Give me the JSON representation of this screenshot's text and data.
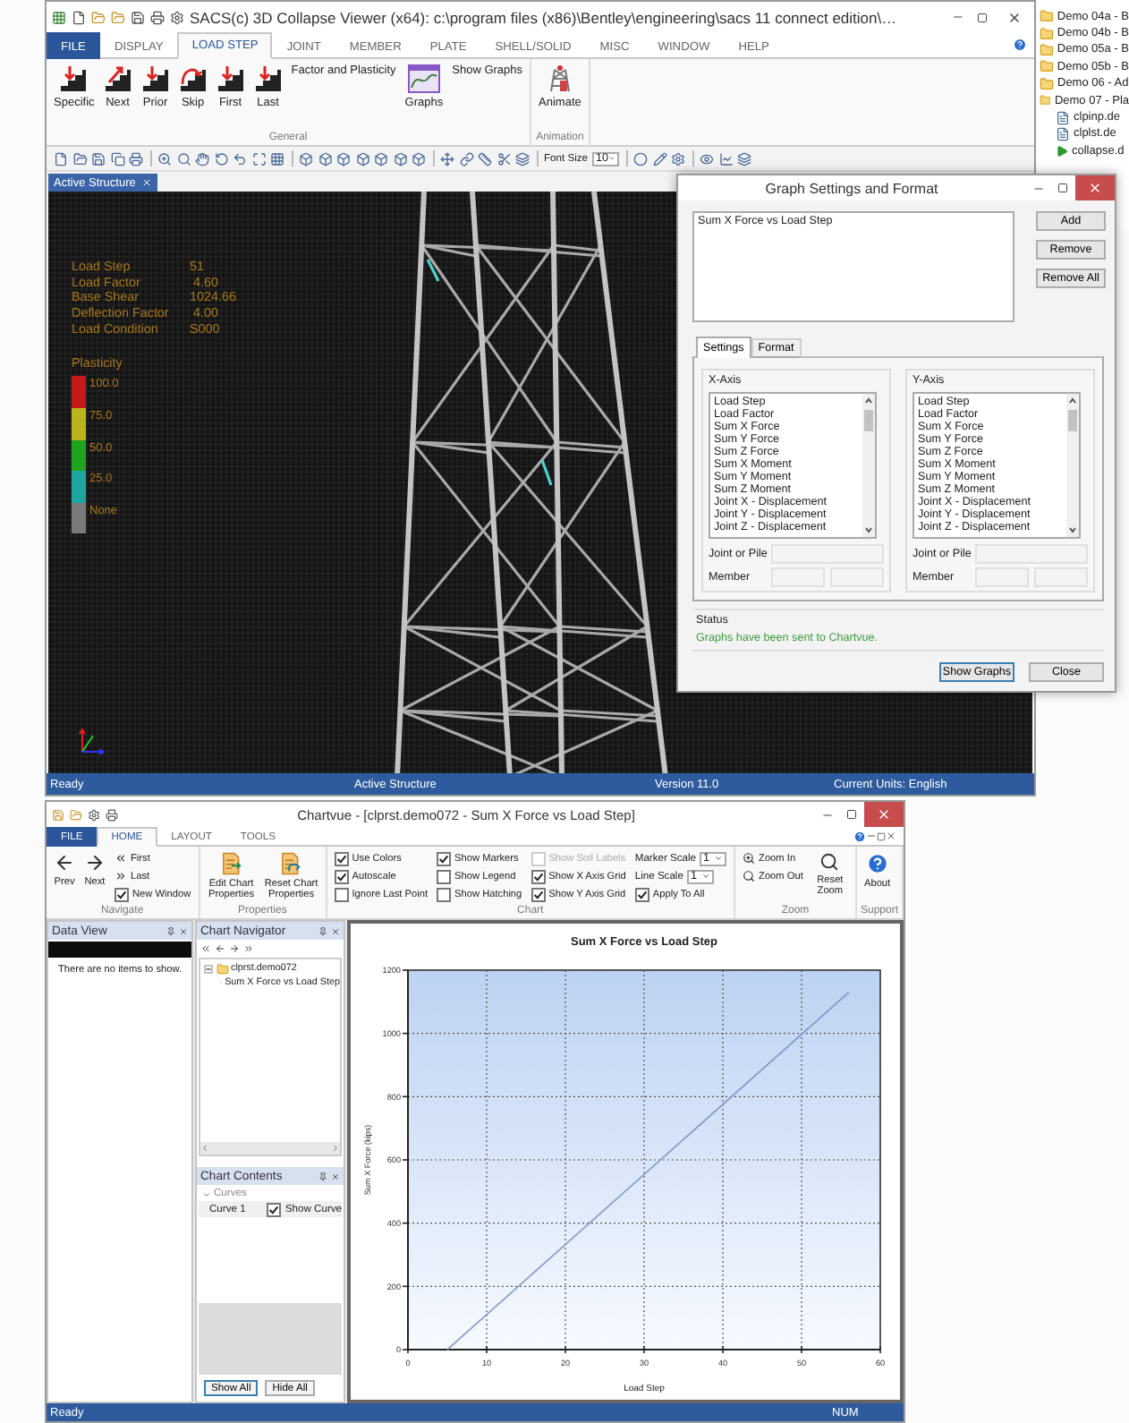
{
  "desktop_files": [
    {
      "label": "Demo 04a - B",
      "kind": "folder"
    },
    {
      "label": "Demo 04b - B",
      "kind": "folder"
    },
    {
      "label": "Demo 05a - B",
      "kind": "folder"
    },
    {
      "label": "Demo 05b - B",
      "kind": "folder"
    },
    {
      "label": "Demo 06 - Ad",
      "kind": "folder"
    },
    {
      "label": "Demo 07 - Pla",
      "kind": "folder"
    },
    {
      "label": "clpinp.de",
      "kind": "file"
    },
    {
      "label": "clplst.de",
      "kind": "file"
    },
    {
      "label": "collapse.d",
      "kind": "run"
    }
  ],
  "sacs_window": {
    "title": "SACS(c) 3D Collapse Viewer (x64):  c:\\program files (x86)\\Bentley\\engineering\\sacs 11 connect edition\\…",
    "tabs": [
      {
        "label": "FILE",
        "kind": "file",
        "selected": false
      },
      {
        "label": "DISPLAY",
        "kind": "tab",
        "selected": false
      },
      {
        "label": "LOAD STEP",
        "kind": "tab",
        "selected": true
      },
      {
        "label": "JOINT",
        "kind": "tab",
        "selected": false
      },
      {
        "label": "MEMBER",
        "kind": "tab",
        "selected": false
      },
      {
        "label": "PLATE",
        "kind": "tab",
        "selected": false
      },
      {
        "label": "SHELL/SOLID",
        "kind": "tab",
        "selected": false
      },
      {
        "label": "MISC",
        "kind": "tab",
        "selected": false
      },
      {
        "label": "WINDOW",
        "kind": "tab",
        "selected": false
      },
      {
        "label": "HELP",
        "kind": "tab",
        "selected": false
      }
    ],
    "ribbon": [
      {
        "label": "General",
        "items": [
          {
            "label": "Specific",
            "kind": "large"
          },
          {
            "label": "Next",
            "kind": "large"
          },
          {
            "label": "Prior",
            "kind": "large"
          },
          {
            "label": "Skip",
            "kind": "large"
          },
          {
            "label": "First",
            "kind": "large"
          },
          {
            "label": "Last",
            "kind": "large"
          },
          {
            "label": "Factor and Plasticity",
            "kind": "text"
          },
          {
            "label": "Graphs",
            "kind": "large"
          },
          {
            "label": "Show Graphs",
            "kind": "text"
          }
        ]
      },
      {
        "label": "Animation",
        "items": [
          {
            "label": "Animate",
            "kind": "large"
          }
        ]
      }
    ],
    "toolbar": {
      "font_size_label": "Font Size",
      "font_size": "10"
    },
    "document_tab": "Active Structure",
    "overlay": {
      "rows": [
        {
          "label": "Load Step",
          "value": "51"
        },
        {
          "label": "Load Factor",
          "value": " 4.60"
        },
        {
          "label": "Base Shear",
          "value": "1024.66"
        },
        {
          "label": "Deflection Factor",
          "value": " 4.00"
        },
        {
          "label": "Load Condition",
          "value": "S000"
        }
      ],
      "legend_title": "Plasticity",
      "legend": [
        {
          "label": "100.0",
          "color": "#c41a1a"
        },
        {
          "label": "75.0",
          "color": "#b8b41a"
        },
        {
          "label": "50.0",
          "color": "#1fa41f"
        },
        {
          "label": "25.0",
          "color": "#1fa6a0"
        },
        {
          "label": "None",
          "color": "#7a7a7a"
        }
      ]
    },
    "status_bar": [
      "Ready",
      "Active Structure",
      "Version 11.0",
      "Current Units: English"
    ]
  },
  "dialog": {
    "title": "Graph Settings and Format",
    "graphs": [
      "Sum X Force vs Load Step"
    ],
    "buttons": [
      "Add",
      "Remove",
      "Remove All"
    ],
    "tabs": [
      {
        "label": "Settings",
        "selected": true
      },
      {
        "label": "Format",
        "selected": false
      }
    ],
    "axes": [
      {
        "title": "X-Axis",
        "options": [
          "Load Step",
          "Load Factor",
          "Sum X Force",
          "Sum Y Force",
          "Sum Z Force",
          "Sum X Moment",
          "Sum Y Moment",
          "Sum Z Moment",
          "Joint X - Displacement",
          "Joint Y - Displacement",
          "Joint Z - Displacement"
        ],
        "joint_label": "Joint or Pile",
        "member_label": "Member"
      },
      {
        "title": "Y-Axis",
        "options": [
          "Load Step",
          "Load Factor",
          "Sum X Force",
          "Sum Y Force",
          "Sum Z Force",
          "Sum X Moment",
          "Sum Y Moment",
          "Sum Z Moment",
          "Joint X - Displacement",
          "Joint Y - Displacement",
          "Joint Z - Displacement"
        ],
        "joint_label": "Joint or Pile",
        "member_label": "Member"
      }
    ],
    "status_title": "Status",
    "status_message": "Graphs have been sent to Chartvue.",
    "footer_buttons": [
      "Show Graphs",
      "Close"
    ]
  },
  "chartvue": {
    "title": "Chartvue - [clprst.demo072 - Sum X Force vs Load Step]",
    "tabs": [
      {
        "label": "FILE",
        "kind": "file",
        "selected": false
      },
      {
        "label": "HOME",
        "kind": "tab",
        "selected": true
      },
      {
        "label": "LAYOUT",
        "kind": "tab",
        "selected": false
      },
      {
        "label": "TOOLS",
        "kind": "tab",
        "selected": false
      }
    ],
    "ribbon": [
      {
        "label": "Navigate",
        "items": [
          {
            "label": "Prev",
            "kind": "large"
          },
          {
            "label": "Next",
            "kind": "large"
          },
          {
            "label": "First",
            "kind": "small"
          },
          {
            "label": "Last",
            "kind": "small"
          },
          {
            "label": "New Window",
            "kind": "check",
            "checked": true,
            "disabled": false
          }
        ]
      },
      {
        "label": "Properties",
        "items": [
          {
            "label": "Edit Chart Properties",
            "kind": "large"
          },
          {
            "label": "Reset Chart Properties",
            "kind": "large"
          }
        ]
      },
      {
        "label": "Chart",
        "items": [
          {
            "label": "Use Colors",
            "kind": "check",
            "checked": true,
            "disabled": false
          },
          {
            "label": "Autoscale",
            "kind": "check",
            "checked": true,
            "disabled": false
          },
          {
            "label": "Ignore Last Point",
            "kind": "check",
            "checked": false,
            "disabled": false
          },
          {
            "label": "Show Markers",
            "kind": "check",
            "checked": true,
            "disabled": false
          },
          {
            "label": "Show Legend",
            "kind": "check",
            "checked": false,
            "disabled": false
          },
          {
            "label": "Show Hatching",
            "kind": "check",
            "checked": false,
            "disabled": false
          },
          {
            "label": "Show Soil Labels",
            "kind": "check",
            "checked": false,
            "disabled": true
          },
          {
            "label": "Show X Axis Grid",
            "kind": "check",
            "checked": true,
            "disabled": false
          },
          {
            "label": "Show Y Axis Grid",
            "kind": "check",
            "checked": true,
            "disabled": false
          },
          {
            "label": "Marker Scale",
            "kind": "select",
            "value": "1"
          },
          {
            "label": "Line Scale",
            "kind": "select",
            "value": "1"
          },
          {
            "label": "Apply To All",
            "kind": "check",
            "checked": true,
            "disabled": false
          }
        ]
      },
      {
        "label": "Zoom",
        "items": [
          {
            "label": "Zoom In",
            "kind": "small"
          },
          {
            "label": "Zoom Out",
            "kind": "small"
          },
          {
            "label": "Reset Zoom",
            "kind": "large"
          }
        ]
      },
      {
        "label": "Support",
        "items": [
          {
            "label": "About",
            "kind": "large"
          }
        ]
      }
    ],
    "data_view": {
      "title": "Data View",
      "empty_text": "There are no items to show."
    },
    "navigator": {
      "title": "Chart Navigator",
      "tree": [
        {
          "label": "clprst.demo072",
          "expanded": true,
          "children": [
            {
              "label": "Sum X Force vs Load Step"
            }
          ]
        }
      ]
    },
    "contents": {
      "title": "Chart Contents",
      "group": "Curves",
      "curves": [
        {
          "checked": true,
          "toggle_label": "Show Curve"
        }
      ],
      "buttons": [
        "Show All",
        "Hide All"
      ]
    },
    "chart_data": {
      "type": "line",
      "title": "Sum X Force vs Load Step",
      "xlabel": "Load Step",
      "ylabel": "Sum X Force  (kips)",
      "x": [
        5,
        56
      ],
      "series": [
        {
          "name": "Curve 1",
          "color": "#8a9ccc",
          "values": [
            0,
            1130
          ]
        }
      ],
      "xlim": [
        0,
        60
      ],
      "ylim": [
        0,
        1200
      ],
      "grid": true,
      "xticks": [
        0,
        10,
        20,
        30,
        40,
        50,
        60
      ],
      "yticks": [
        0,
        200,
        400,
        600,
        800,
        1000,
        1200
      ]
    },
    "status_bar": [
      "Ready",
      "NUM"
    ]
  }
}
